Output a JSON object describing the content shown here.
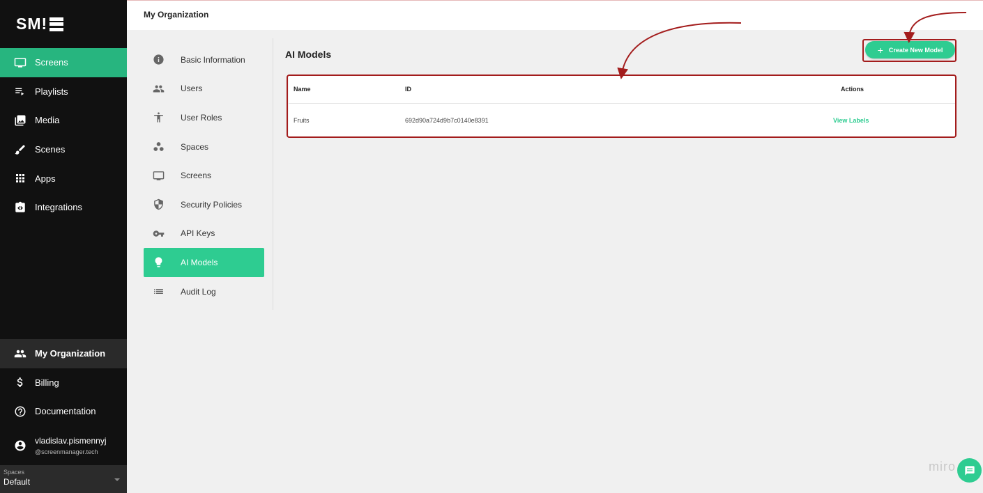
{
  "logo": {
    "text": "SM!"
  },
  "sidebar": {
    "items": [
      {
        "label": "Screens",
        "icon": "monitor-icon",
        "active": true
      },
      {
        "label": "Playlists",
        "icon": "playlist-icon"
      },
      {
        "label": "Media",
        "icon": "media-icon"
      },
      {
        "label": "Scenes",
        "icon": "brush-icon"
      },
      {
        "label": "Apps",
        "icon": "apps-grid-icon"
      },
      {
        "label": "Integrations",
        "icon": "integrations-icon"
      }
    ],
    "bottom": [
      {
        "label": "My Organization",
        "icon": "people-icon"
      },
      {
        "label": "Billing",
        "icon": "dollar-icon"
      },
      {
        "label": "Documentation",
        "icon": "help-circle-icon"
      }
    ],
    "user": {
      "name": "vladislav.pismennyj",
      "email": "@screenmanager.tech"
    },
    "spaces": {
      "label": "Spaces",
      "value": "Default"
    }
  },
  "header": {
    "title": "My Organization"
  },
  "subnav": {
    "items": [
      {
        "label": "Basic Information",
        "icon": "info-icon"
      },
      {
        "label": "Users",
        "icon": "people-icon"
      },
      {
        "label": "User Roles",
        "icon": "accessibility-icon"
      },
      {
        "label": "Spaces",
        "icon": "workspaces-icon"
      },
      {
        "label": "Screens",
        "icon": "monitor-icon"
      },
      {
        "label": "Security Policies",
        "icon": "shield-icon"
      },
      {
        "label": "API Keys",
        "icon": "key-icon"
      },
      {
        "label": "AI Models",
        "icon": "lightbulb-icon",
        "active": true
      },
      {
        "label": "Audit Log",
        "icon": "list-icon"
      }
    ]
  },
  "main": {
    "title": "AI Models",
    "create_button": "Create New Model",
    "table": {
      "headers": {
        "name": "Name",
        "id": "ID",
        "actions": "Actions"
      },
      "rows": [
        {
          "name": "Fruits",
          "id": "692d90a724d9b7c0140e8391",
          "action": "View Labels"
        }
      ]
    }
  },
  "watermark": {
    "text": "miro"
  },
  "colors": {
    "accent": "#2ecc91",
    "sidebar_bg": "#111111",
    "annotation": "#a31c1c"
  }
}
